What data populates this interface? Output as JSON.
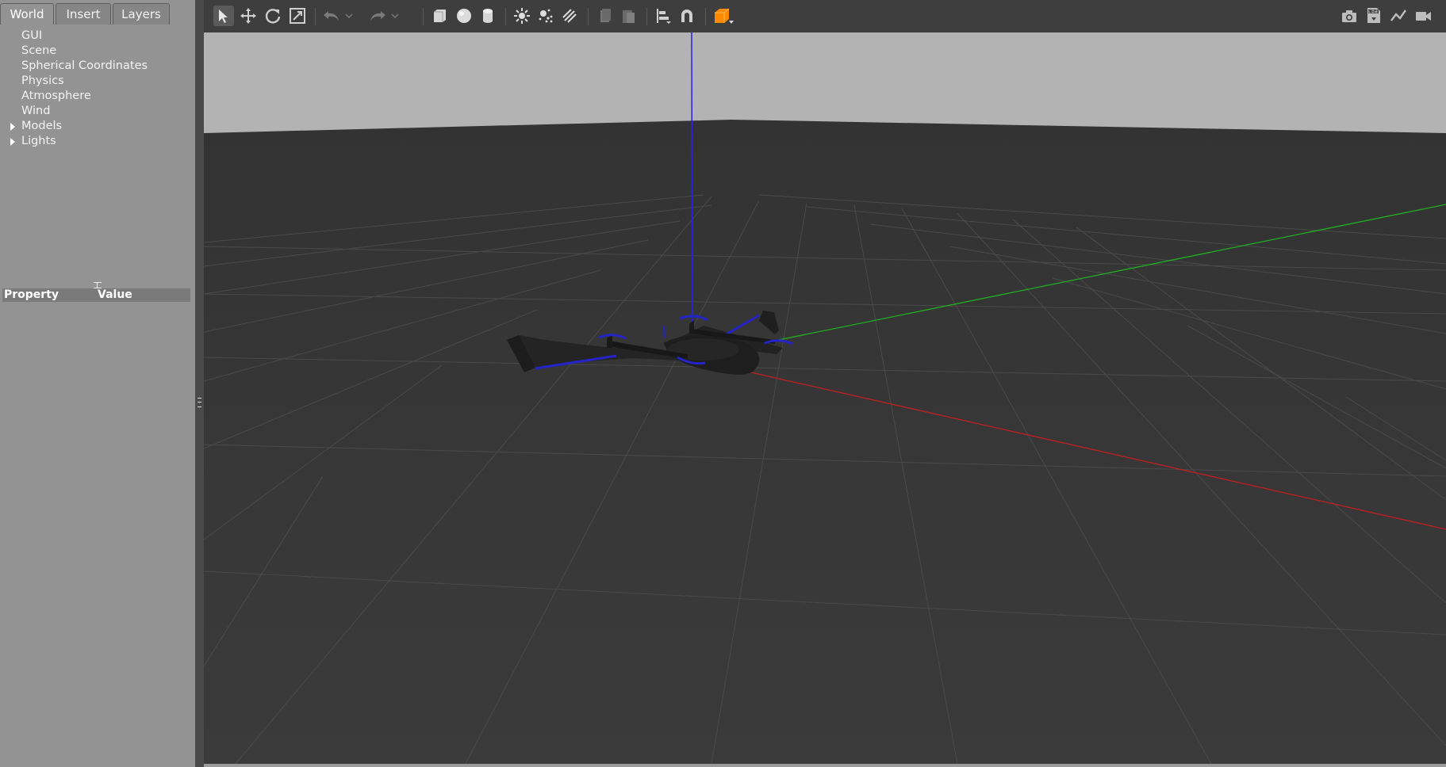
{
  "tabs": {
    "world": "World",
    "insert": "Insert",
    "layers": "Layers"
  },
  "tree": {
    "items": [
      {
        "label": "GUI",
        "expandable": false
      },
      {
        "label": "Scene",
        "expandable": false
      },
      {
        "label": "Spherical Coordinates",
        "expandable": false
      },
      {
        "label": "Physics",
        "expandable": false
      },
      {
        "label": "Atmosphere",
        "expandable": false
      },
      {
        "label": "Wind",
        "expandable": false
      },
      {
        "label": "Models",
        "expandable": true
      },
      {
        "label": "Lights",
        "expandable": true
      }
    ]
  },
  "properties": {
    "col_property": "Property",
    "col_value": "Value"
  },
  "toolbar": {
    "left_icons": [
      "select-arrow-icon",
      "translate-icon",
      "rotate-icon",
      "scale-icon",
      "undo-icon",
      "undo-dropdown-icon",
      "redo-icon",
      "redo-dropdown-icon",
      "box-icon",
      "sphere-icon",
      "cylinder-icon",
      "point-light-icon",
      "spot-light-icon",
      "directional-light-icon",
      "copy-icon",
      "paste-icon",
      "align-icon",
      "snap-magnet-icon",
      "view-angle-icon"
    ],
    "right_icons": [
      "screenshot-camera-icon",
      "log-icon",
      "plot-icon",
      "video-record-icon"
    ]
  },
  "colors": {
    "panel": "#939393",
    "viewport_floor": "#383838",
    "sky": "#b3b3b3",
    "axis_x": "#c42020",
    "axis_y": "#22b022",
    "axis_z": "#2626d9",
    "accent_orange": "#ff8a00"
  }
}
